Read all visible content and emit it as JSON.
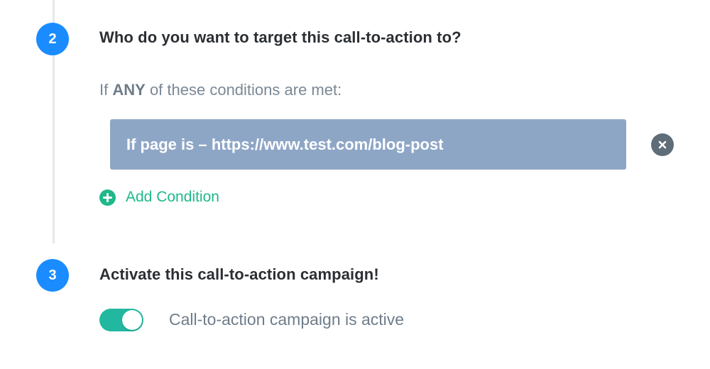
{
  "step2": {
    "number": "2",
    "title": "Who do you want to target this call-to-action to?",
    "conditions_prefix": "If",
    "conditions_keyword": "ANY",
    "conditions_suffix": "of these conditions are met:",
    "condition": {
      "text": "If page is – https://www.test.com/blog-post",
      "remove_icon": "close-icon"
    },
    "add_condition_label": "Add Condition",
    "add_condition_icon": "plus-circle-icon"
  },
  "step3": {
    "number": "3",
    "title": "Activate this call-to-action campaign!",
    "toggle": {
      "on": true,
      "label": "Call-to-action campaign is active"
    }
  },
  "colors": {
    "step_circle": "#1a8cff",
    "condition_box": "#8ea6c6",
    "add_condition": "#1fb88a",
    "toggle_on": "#22b8a0"
  }
}
